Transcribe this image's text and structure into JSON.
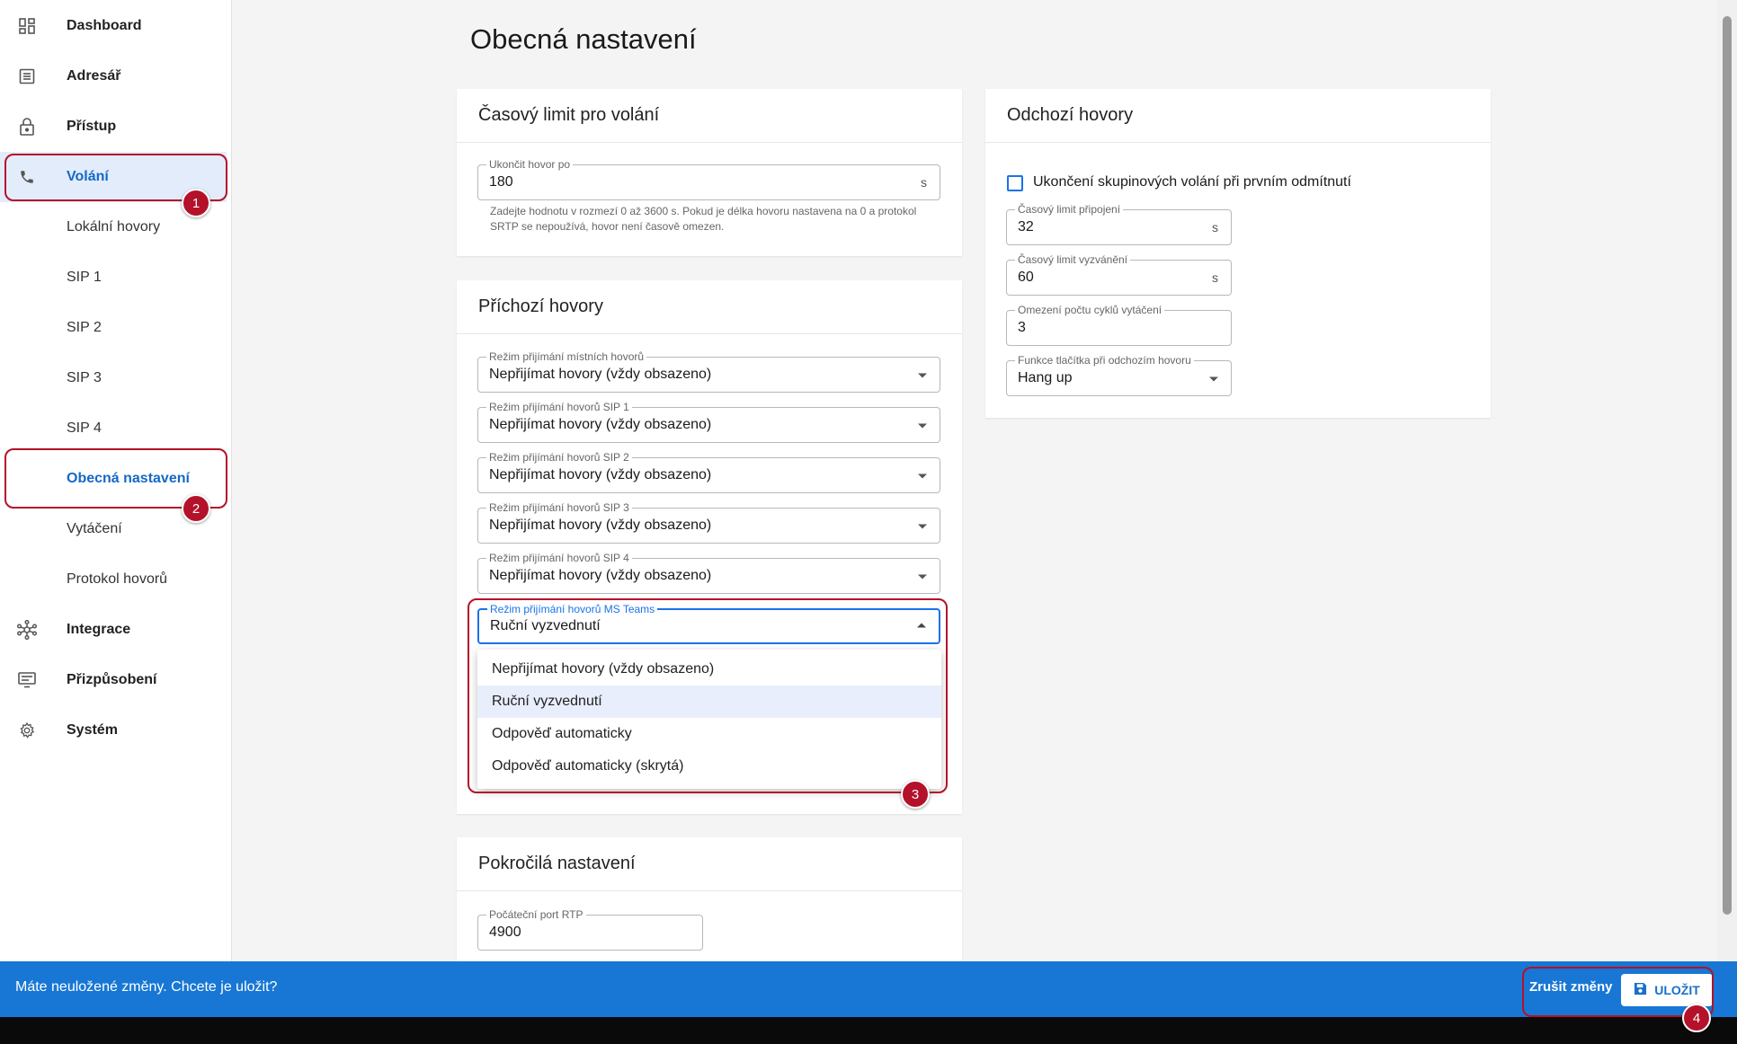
{
  "sidebar": {
    "items": [
      {
        "label": "Dashboard",
        "icon": "dashboard-icon"
      },
      {
        "label": "Adresář",
        "icon": "address-book-icon"
      },
      {
        "label": "Přístup",
        "icon": "lock-icon"
      },
      {
        "label": "Volání",
        "icon": "phone-icon"
      },
      {
        "label": "Lokální hovory"
      },
      {
        "label": "SIP 1"
      },
      {
        "label": "SIP 2"
      },
      {
        "label": "SIP 3"
      },
      {
        "label": "SIP 4"
      },
      {
        "label": "Obecná nastavení"
      },
      {
        "label": "Vytáčení"
      },
      {
        "label": "Protokol hovorů"
      },
      {
        "label": "Integrace",
        "icon": "network-icon"
      },
      {
        "label": "Přizpůsobení",
        "icon": "customize-icon"
      },
      {
        "label": "Systém",
        "icon": "gear-icon"
      }
    ]
  },
  "page": {
    "title": "Obecná nastavení"
  },
  "call_timeout": {
    "title": "Časový limit pro volání",
    "field_label": "Ukončit hovor po",
    "field_value": "180",
    "unit": "s",
    "helper_line1": "Zadejte hodnotu v rozmezí 0 až 3600 s. Pokud je délka hovoru nastavena na 0 a protokol",
    "helper_line2": "SRTP se nepoužívá, hovor není časově omezen."
  },
  "incoming": {
    "title": "Příchozí hovory",
    "fields": [
      {
        "label": "Režim přijímání místních hovorů",
        "value": "Nepřijímat hovory (vždy obsazeno)"
      },
      {
        "label": "Režim přijímání hovorů SIP 1",
        "value": "Nepřijímat hovory (vždy obsazeno)"
      },
      {
        "label": "Režim přijímání hovorů SIP 2",
        "value": "Nepřijímat hovory (vždy obsazeno)"
      },
      {
        "label": "Režim přijímání hovorů SIP 3",
        "value": "Nepřijímat hovory (vždy obsazeno)"
      },
      {
        "label": "Režim přijímání hovorů SIP 4",
        "value": "Nepřijímat hovory (vždy obsazeno)"
      },
      {
        "label": "Režim přijímání hovorů MS Teams",
        "value": "Ruční vyzvednutí"
      }
    ],
    "menu_options": [
      "Nepřijímat hovory (vždy obsazeno)",
      "Ruční vyzvednutí",
      "Odpověď automaticky",
      "Odpověď automaticky (skrytá)"
    ],
    "menu_selected": "Ruční vyzvednutí"
  },
  "advanced": {
    "title": "Pokročilá nastavení",
    "rtp_label": "Počáteční port RTP",
    "rtp_value": "4900"
  },
  "outgoing": {
    "title": "Odchozí hovory",
    "checkbox_label": "Ukončení skupinových volání při prvním odmítnutí",
    "checkbox_checked": false,
    "connect_label": "Časový limit připojení",
    "connect_value": "32",
    "ring_label": "Časový limit vyzvánění",
    "ring_value": "60",
    "cycles_label": "Omezení počtu cyklů vytáčení",
    "cycles_value": "3",
    "button_label": "Funkce tlačítka při odchozím hovoru",
    "button_value": "Hang up",
    "unit": "s"
  },
  "footer": {
    "message": "Máte neuložené změny. Chcete je uložit?",
    "cancel_label": "Zrušit změny",
    "save_label": "ULOŽIT"
  },
  "annotations": [
    "1",
    "2",
    "3",
    "4"
  ],
  "colors": {
    "accent": "#1877d4",
    "annotation": "#b3122a",
    "active_bg": "#e3ecfb"
  }
}
